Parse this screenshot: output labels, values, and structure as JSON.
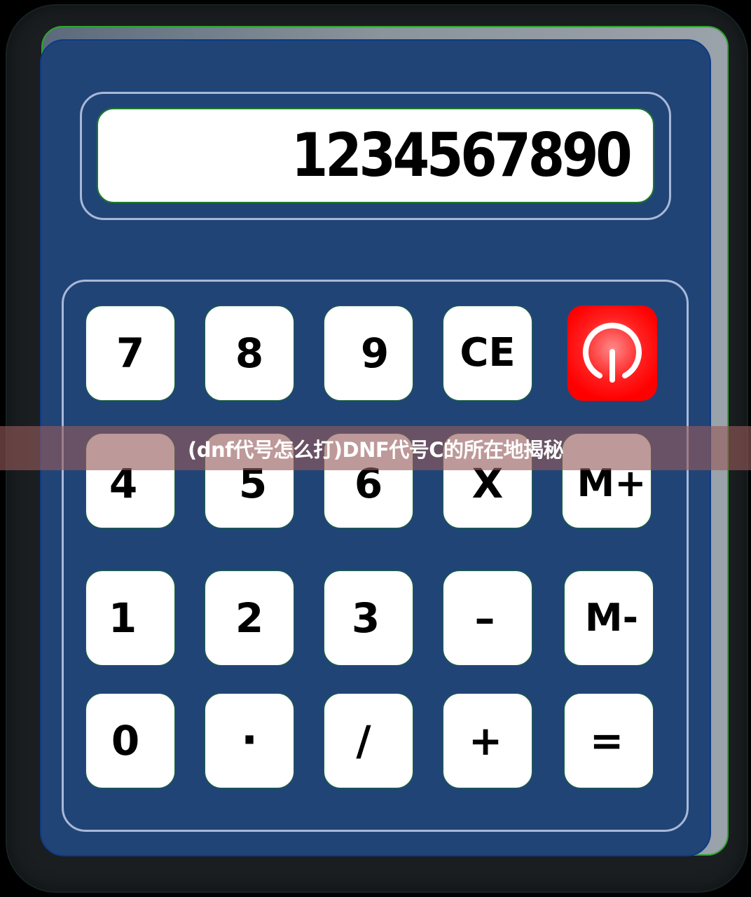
{
  "display": {
    "value": "1234567890"
  },
  "keys": {
    "row1": [
      "7",
      "8",
      "9",
      "CE"
    ],
    "row2": [
      "4",
      "5",
      "6",
      "X",
      "M+"
    ],
    "row3": [
      "1",
      "2",
      "3",
      "–",
      "M-"
    ],
    "row4": [
      "0",
      "·",
      "/",
      "+",
      "="
    ]
  },
  "power_button": {
    "icon": "power-icon"
  },
  "banner": {
    "title": "(dnf代号怎么打)DNF代号C的所在地揭秘"
  },
  "colors": {
    "body": "#214477",
    "frame_outline": "#a9b8d8",
    "power": "#ff0000",
    "key_face": "#ffffff"
  }
}
